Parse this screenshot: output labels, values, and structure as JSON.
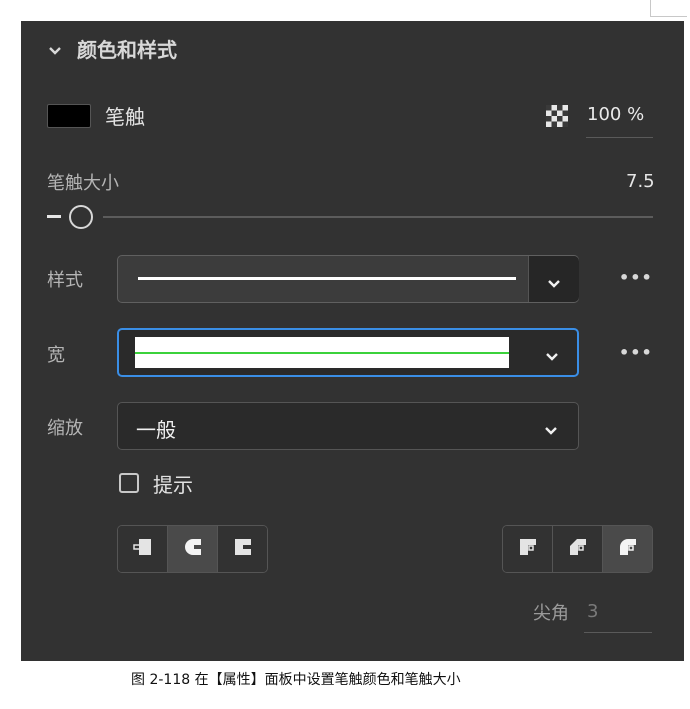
{
  "section": {
    "title": "颜色和样式",
    "expanded_icon": "chevron-down-icon"
  },
  "stroke": {
    "label": "笔触",
    "color": "#000000",
    "opacity_icon": "checkerboard-icon",
    "opacity": "100 %"
  },
  "stroke_size": {
    "label": "笔触大小",
    "value": "7.5",
    "slider_fraction": 0.05
  },
  "style_row": {
    "label": "样式",
    "more": "•••"
  },
  "width_row": {
    "label": "宽",
    "more": "•••",
    "accent_color": "#3a8ee6",
    "profile_color": "#3bd23b"
  },
  "scale_row": {
    "label": "缩放",
    "value": "一般"
  },
  "hint": {
    "label": "提示",
    "checked": false
  },
  "caps": {
    "items": [
      "butt-cap-icon",
      "round-cap-icon",
      "square-cap-icon"
    ],
    "selected": 1
  },
  "joins": {
    "items": [
      "miter-join-icon",
      "bevel-join-icon",
      "round-join-icon"
    ],
    "selected": 2
  },
  "miter": {
    "label": "尖角",
    "value": "3"
  },
  "caption": "图 2-118 在【属性】面板中设置笔触颜色和笔触大小"
}
